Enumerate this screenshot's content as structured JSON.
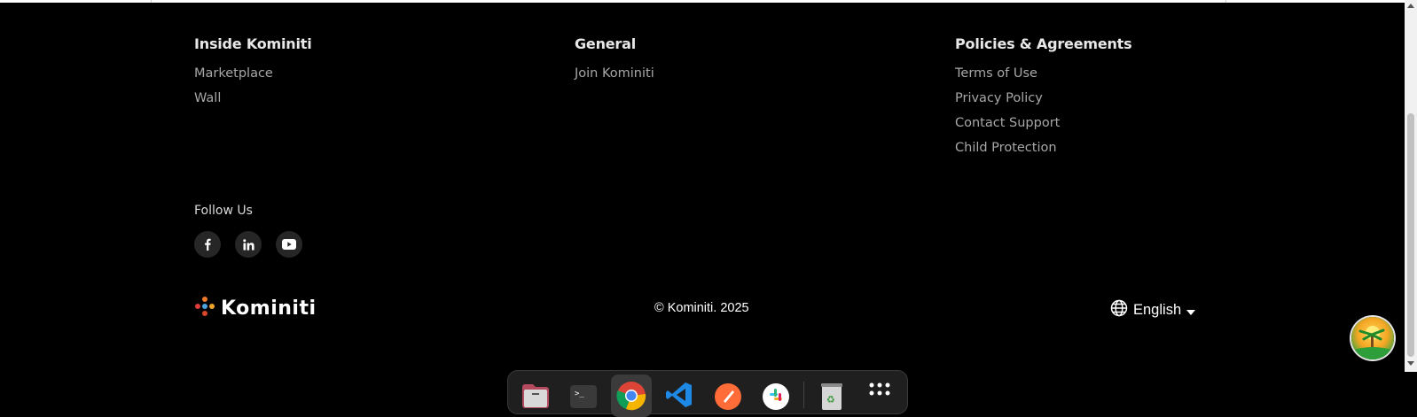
{
  "footer": {
    "columns": [
      {
        "title": "Inside Kominiti",
        "links": [
          "Marketplace",
          "Wall"
        ]
      },
      {
        "title": "General",
        "links": [
          "Join Kominiti"
        ]
      },
      {
        "title": "Policies & Agreements",
        "links": [
          "Terms of Use",
          "Privacy Policy",
          "Contact Support",
          "Child Protection"
        ]
      }
    ],
    "follow": {
      "title": "Follow Us",
      "icons": [
        "facebook-icon",
        "linkedin-icon",
        "youtube-icon"
      ]
    },
    "brand": {
      "name": "Kominiti",
      "logo_icon": "kominiti-logo-icon"
    },
    "copyright": "© Kominiti. 2025",
    "language": {
      "selected": "English",
      "icon": "globe-icon"
    }
  },
  "dock": {
    "items": [
      "files-icon",
      "terminal-icon",
      "chrome-icon",
      "vscode-icon",
      "postman-icon",
      "slack-icon",
      "trash-icon",
      "app-grid-icon"
    ],
    "active": "chrome-icon"
  },
  "colors": {
    "background": "#000000",
    "text_muted": "#a7a7a7",
    "social_bg": "#262626"
  }
}
